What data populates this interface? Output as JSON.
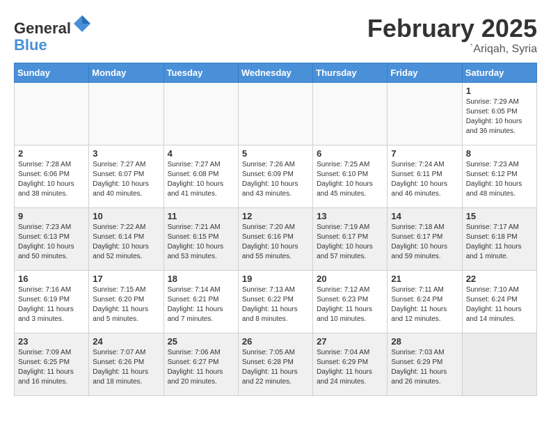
{
  "logo": {
    "general": "General",
    "blue": "Blue"
  },
  "header": {
    "month": "February 2025",
    "location": "`Ariqah, Syria"
  },
  "weekdays": [
    "Sunday",
    "Monday",
    "Tuesday",
    "Wednesday",
    "Thursday",
    "Friday",
    "Saturday"
  ],
  "weeks": [
    [
      {
        "day": "",
        "info": ""
      },
      {
        "day": "",
        "info": ""
      },
      {
        "day": "",
        "info": ""
      },
      {
        "day": "",
        "info": ""
      },
      {
        "day": "",
        "info": ""
      },
      {
        "day": "",
        "info": ""
      },
      {
        "day": "1",
        "info": "Sunrise: 7:29 AM\nSunset: 6:05 PM\nDaylight: 10 hours and 36 minutes."
      }
    ],
    [
      {
        "day": "2",
        "info": "Sunrise: 7:28 AM\nSunset: 6:06 PM\nDaylight: 10 hours and 38 minutes."
      },
      {
        "day": "3",
        "info": "Sunrise: 7:27 AM\nSunset: 6:07 PM\nDaylight: 10 hours and 40 minutes."
      },
      {
        "day": "4",
        "info": "Sunrise: 7:27 AM\nSunset: 6:08 PM\nDaylight: 10 hours and 41 minutes."
      },
      {
        "day": "5",
        "info": "Sunrise: 7:26 AM\nSunset: 6:09 PM\nDaylight: 10 hours and 43 minutes."
      },
      {
        "day": "6",
        "info": "Sunrise: 7:25 AM\nSunset: 6:10 PM\nDaylight: 10 hours and 45 minutes."
      },
      {
        "day": "7",
        "info": "Sunrise: 7:24 AM\nSunset: 6:11 PM\nDaylight: 10 hours and 46 minutes."
      },
      {
        "day": "8",
        "info": "Sunrise: 7:23 AM\nSunset: 6:12 PM\nDaylight: 10 hours and 48 minutes."
      }
    ],
    [
      {
        "day": "9",
        "info": "Sunrise: 7:23 AM\nSunset: 6:13 PM\nDaylight: 10 hours and 50 minutes."
      },
      {
        "day": "10",
        "info": "Sunrise: 7:22 AM\nSunset: 6:14 PM\nDaylight: 10 hours and 52 minutes."
      },
      {
        "day": "11",
        "info": "Sunrise: 7:21 AM\nSunset: 6:15 PM\nDaylight: 10 hours and 53 minutes."
      },
      {
        "day": "12",
        "info": "Sunrise: 7:20 AM\nSunset: 6:16 PM\nDaylight: 10 hours and 55 minutes."
      },
      {
        "day": "13",
        "info": "Sunrise: 7:19 AM\nSunset: 6:17 PM\nDaylight: 10 hours and 57 minutes."
      },
      {
        "day": "14",
        "info": "Sunrise: 7:18 AM\nSunset: 6:17 PM\nDaylight: 10 hours and 59 minutes."
      },
      {
        "day": "15",
        "info": "Sunrise: 7:17 AM\nSunset: 6:18 PM\nDaylight: 11 hours and 1 minute."
      }
    ],
    [
      {
        "day": "16",
        "info": "Sunrise: 7:16 AM\nSunset: 6:19 PM\nDaylight: 11 hours and 3 minutes."
      },
      {
        "day": "17",
        "info": "Sunrise: 7:15 AM\nSunset: 6:20 PM\nDaylight: 11 hours and 5 minutes."
      },
      {
        "day": "18",
        "info": "Sunrise: 7:14 AM\nSunset: 6:21 PM\nDaylight: 11 hours and 7 minutes."
      },
      {
        "day": "19",
        "info": "Sunrise: 7:13 AM\nSunset: 6:22 PM\nDaylight: 11 hours and 8 minutes."
      },
      {
        "day": "20",
        "info": "Sunrise: 7:12 AM\nSunset: 6:23 PM\nDaylight: 11 hours and 10 minutes."
      },
      {
        "day": "21",
        "info": "Sunrise: 7:11 AM\nSunset: 6:24 PM\nDaylight: 11 hours and 12 minutes."
      },
      {
        "day": "22",
        "info": "Sunrise: 7:10 AM\nSunset: 6:24 PM\nDaylight: 11 hours and 14 minutes."
      }
    ],
    [
      {
        "day": "23",
        "info": "Sunrise: 7:09 AM\nSunset: 6:25 PM\nDaylight: 11 hours and 16 minutes."
      },
      {
        "day": "24",
        "info": "Sunrise: 7:07 AM\nSunset: 6:26 PM\nDaylight: 11 hours and 18 minutes."
      },
      {
        "day": "25",
        "info": "Sunrise: 7:06 AM\nSunset: 6:27 PM\nDaylight: 11 hours and 20 minutes."
      },
      {
        "day": "26",
        "info": "Sunrise: 7:05 AM\nSunset: 6:28 PM\nDaylight: 11 hours and 22 minutes."
      },
      {
        "day": "27",
        "info": "Sunrise: 7:04 AM\nSunset: 6:29 PM\nDaylight: 11 hours and 24 minutes."
      },
      {
        "day": "28",
        "info": "Sunrise: 7:03 AM\nSunset: 6:29 PM\nDaylight: 11 hours and 26 minutes."
      },
      {
        "day": "",
        "info": ""
      }
    ]
  ]
}
